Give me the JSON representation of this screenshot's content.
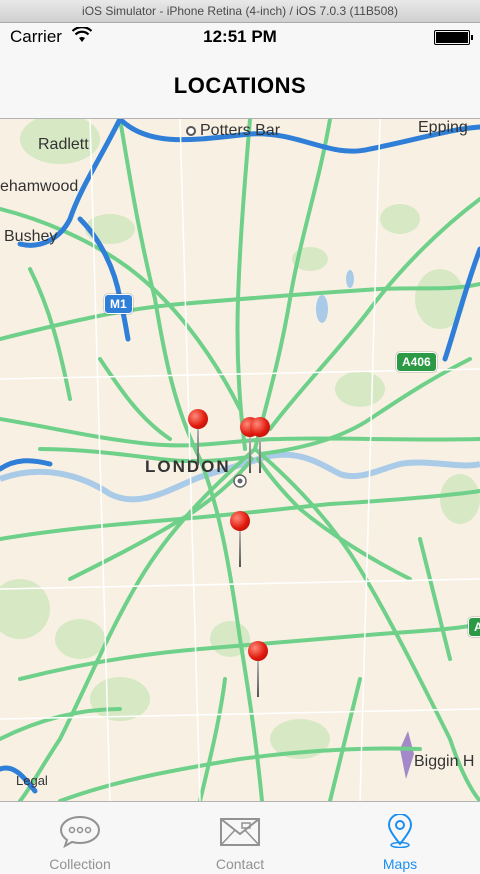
{
  "simulator": {
    "title": "iOS Simulator - iPhone Retina (4-inch) / iOS 7.0.3 (11B508)"
  },
  "status_bar": {
    "carrier": "Carrier",
    "time": "12:51 PM"
  },
  "nav": {
    "title": "LOCATIONS"
  },
  "map": {
    "places": {
      "radlett": "Radlett",
      "potters_bar": "Potters Bar",
      "borehamwood": "ehamwood",
      "bushey": "Bushey",
      "london": "LONDON",
      "biggin": "Biggin H",
      "epping": "Epping",
      "legal": "Legal"
    },
    "shields": {
      "m1": "M1",
      "a406": "A406",
      "a_edge": "A"
    },
    "pin_count": 5
  },
  "tabs": [
    {
      "label": "Collection",
      "icon": "chat-bubble-icon",
      "active": false
    },
    {
      "label": "Contact",
      "icon": "envelope-icon",
      "active": false
    },
    {
      "label": "Maps",
      "icon": "map-pin-icon",
      "active": true
    }
  ],
  "colors": {
    "accent": "#1a8ff0",
    "motorway": "#2f7fd8",
    "main_road": "#6fd08a",
    "water": "#a9cbe8",
    "park": "#d7e8c4",
    "pin": "#e01a0e"
  }
}
